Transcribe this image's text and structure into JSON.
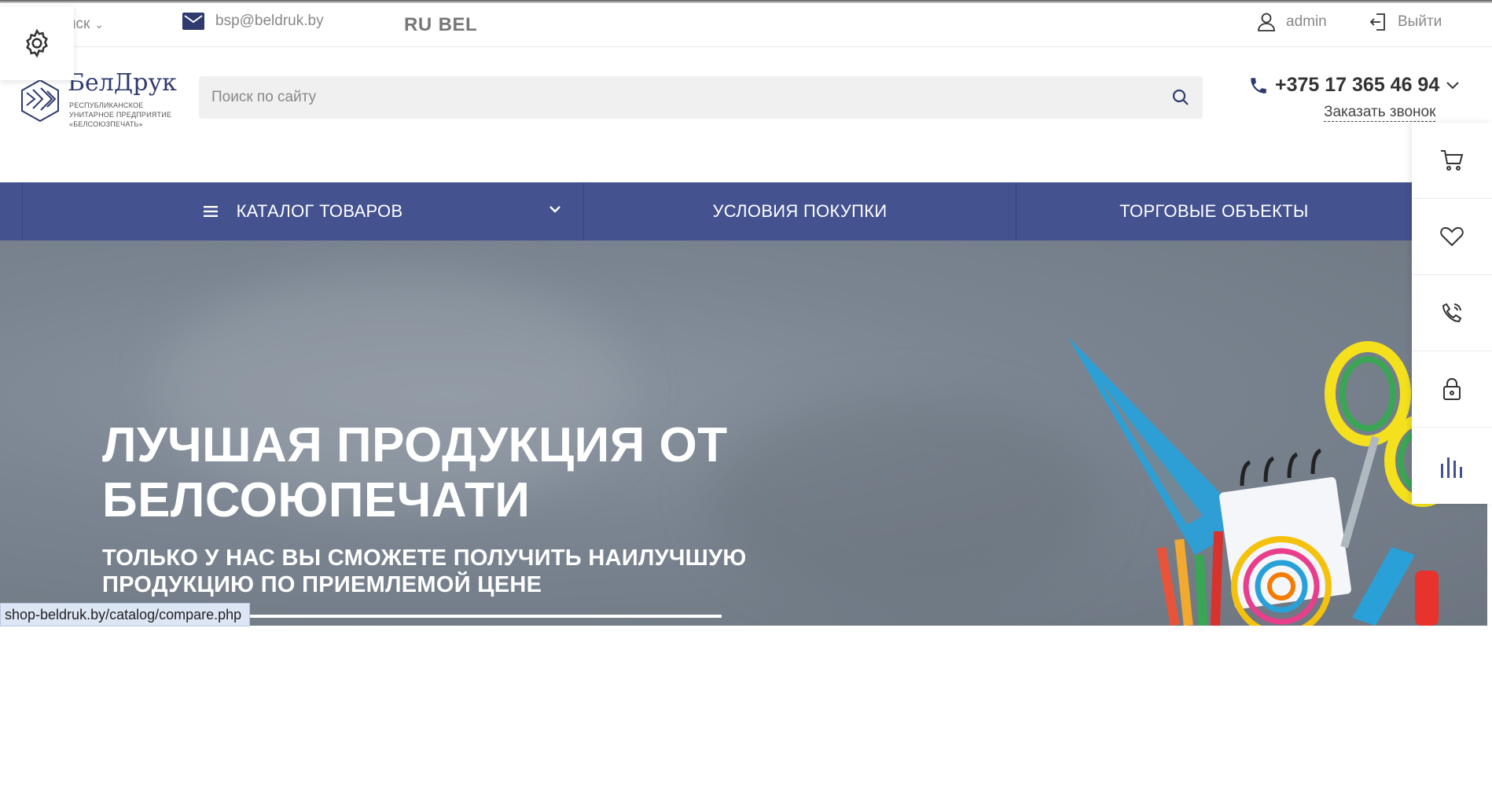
{
  "topbar": {
    "city": "нск",
    "email": "bsp@beldruk.by",
    "languages": [
      "RU",
      "BEL"
    ],
    "user": "admin",
    "logout": "Выйти"
  },
  "header": {
    "logo_name": "БелДрук",
    "logo_subtitle": "РЕСПУБЛИКАНСКОЕ УНИТАРНОЕ ПРЕДПРИЯТИЕ «БЕЛСОЮЗПЕЧАТЬ»",
    "search_placeholder": "Поиск по сайту",
    "phone": "+375 17 365 46 94",
    "callback": "Заказать звонок"
  },
  "nav": {
    "items": [
      {
        "label": "КАТАЛОГ ТОВАРОВ"
      },
      {
        "label": "УСЛОВИЯ ПОКУПКИ"
      },
      {
        "label": "ТОРГОВЫЕ ОБЪЕКТЫ"
      }
    ]
  },
  "hero": {
    "title": "ЛУЧШАЯ ПРОДУКЦИЯ ОТ БЕЛСОЮПЕЧАТИ",
    "subtitle": "ТОЛЬКО У НАС ВЫ СМОЖЕТЕ ПОЛУЧИТЬ НАИЛУЧШУЮ ПРОДУКЦИЮ ПО ПРИЕМЛЕМОЙ ЦЕНЕ"
  },
  "sidepanel": {
    "icons": [
      "cart-icon",
      "heart-icon",
      "phone-call-icon",
      "lock-icon",
      "compare-icon"
    ]
  },
  "status_url": "shop-beldruk.by/catalog/compare.php",
  "colors": {
    "nav_bg": "#44528f",
    "accent": "#2f3a6e",
    "search_bg": "#f0f0f0"
  }
}
